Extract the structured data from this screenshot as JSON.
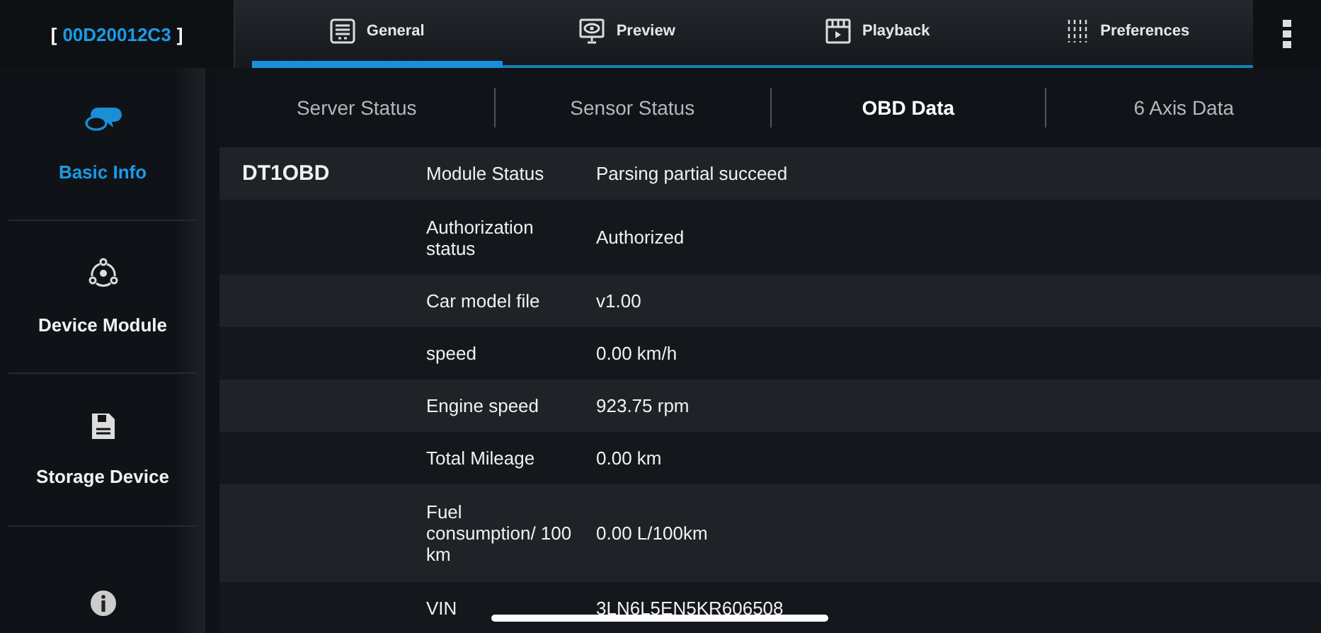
{
  "device_id": {
    "open": "[",
    "id": "00D20012C3",
    "close": "]"
  },
  "tabs": [
    {
      "label": "General",
      "selected": true
    },
    {
      "label": "Preview",
      "selected": false
    },
    {
      "label": "Playback",
      "selected": false
    },
    {
      "label": "Preferences",
      "selected": false
    }
  ],
  "sidebar": {
    "items": [
      {
        "label": "Basic Info",
        "selected": true
      },
      {
        "label": "Device Module",
        "selected": false
      },
      {
        "label": "Storage Device",
        "selected": false
      },
      {
        "selected": false
      }
    ]
  },
  "subtabs": [
    {
      "label": "Server Status",
      "selected": false
    },
    {
      "label": "Sensor Status",
      "selected": false
    },
    {
      "label": "OBD Data",
      "selected": true
    },
    {
      "label": "6 Axis Data",
      "selected": false
    }
  ],
  "table": {
    "module": "DT1OBD",
    "rows": [
      {
        "label": "Module Status",
        "value": "Parsing partial succeed"
      },
      {
        "label": "Authorization status",
        "value": "Authorized"
      },
      {
        "label": "Car model file",
        "value": "v1.00"
      },
      {
        "label": "speed",
        "value": "0.00 km/h"
      },
      {
        "label": "Engine speed",
        "value": "923.75 rpm"
      },
      {
        "label": "Total Mileage",
        "value": "0.00 km"
      },
      {
        "label": "Fuel consumption/ 100 km",
        "value": "0.00 L/100km"
      },
      {
        "label": "VIN",
        "value": "3LN6L5EN5KR606508"
      }
    ]
  }
}
